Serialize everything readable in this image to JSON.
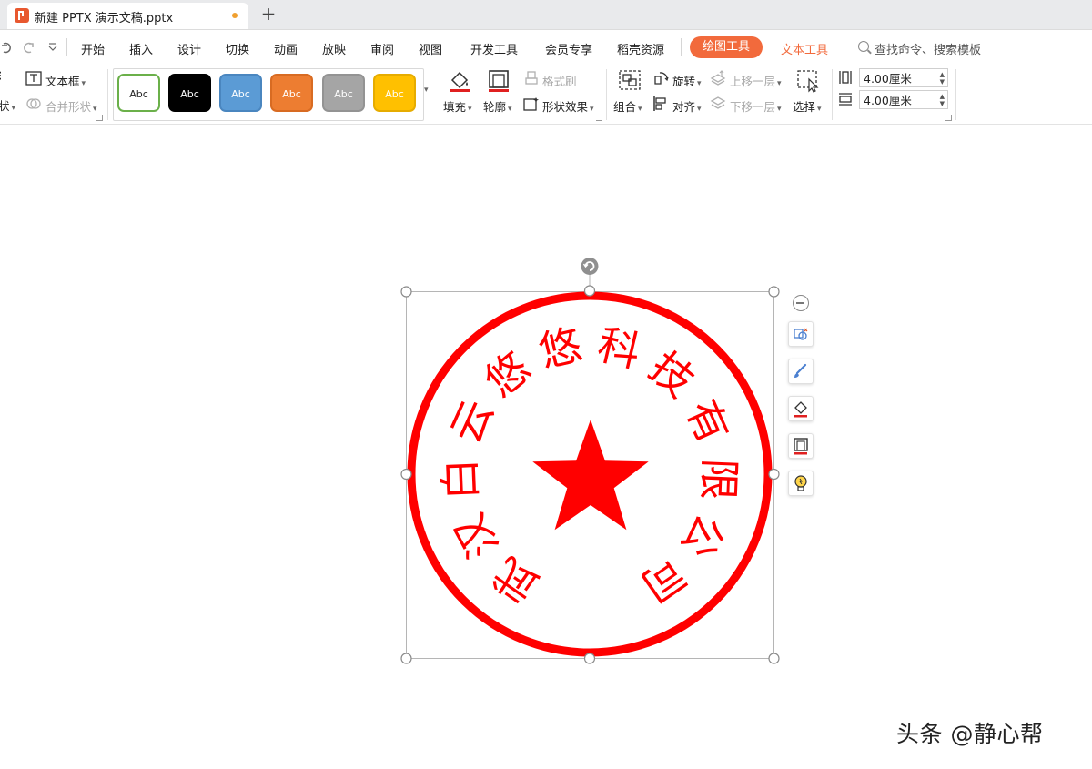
{
  "tab": {
    "title": "新建 PPTX 演示文稿.pptx",
    "new_tab_symbol": "+"
  },
  "menu": {
    "items": [
      "开始",
      "插入",
      "设计",
      "切换",
      "动画",
      "放映",
      "审阅",
      "视图",
      "开发工具",
      "会员专享",
      "稻壳资源"
    ],
    "active": "绘图工具",
    "text_tool": "文本工具",
    "search_placeholder": "查找命令、搜索模板"
  },
  "ribbon": {
    "textbox": "文本框",
    "merge_shapes": "合并形状",
    "shape_cut": "状",
    "styles": [
      {
        "label": "Abc",
        "bg": "#ffffff",
        "border": "#6bb04a",
        "color": "#222222"
      },
      {
        "label": "Abc",
        "bg": "#000000",
        "border": "#000000",
        "color": "#ffffff"
      },
      {
        "label": "Abc",
        "bg": "#5b9bd5",
        "border": "#4a86bf",
        "color": "#ffffff"
      },
      {
        "label": "Abc",
        "bg": "#ed7d31",
        "border": "#d86b22",
        "color": "#ffffff"
      },
      {
        "label": "Abc",
        "bg": "#a5a5a5",
        "border": "#939393",
        "color": "#ffffff"
      },
      {
        "label": "Abc",
        "bg": "#ffc000",
        "border": "#e6ac00",
        "color": "#ffffff"
      }
    ],
    "fill": "填充",
    "outline": "轮廓",
    "format_painter": "格式刷",
    "shape_effects": "形状效果",
    "group": "组合",
    "rotate": "旋转",
    "align": "对齐",
    "bring_forward": "上移一层",
    "send_backward": "下移一层",
    "select": "选择",
    "height_value": "4.00厘米",
    "width_value": "4.00厘米"
  },
  "stamp": {
    "text": "武汉白云悠悠科技有限公司",
    "color": "#ff0000"
  },
  "watermark": "头条 @静心帮"
}
